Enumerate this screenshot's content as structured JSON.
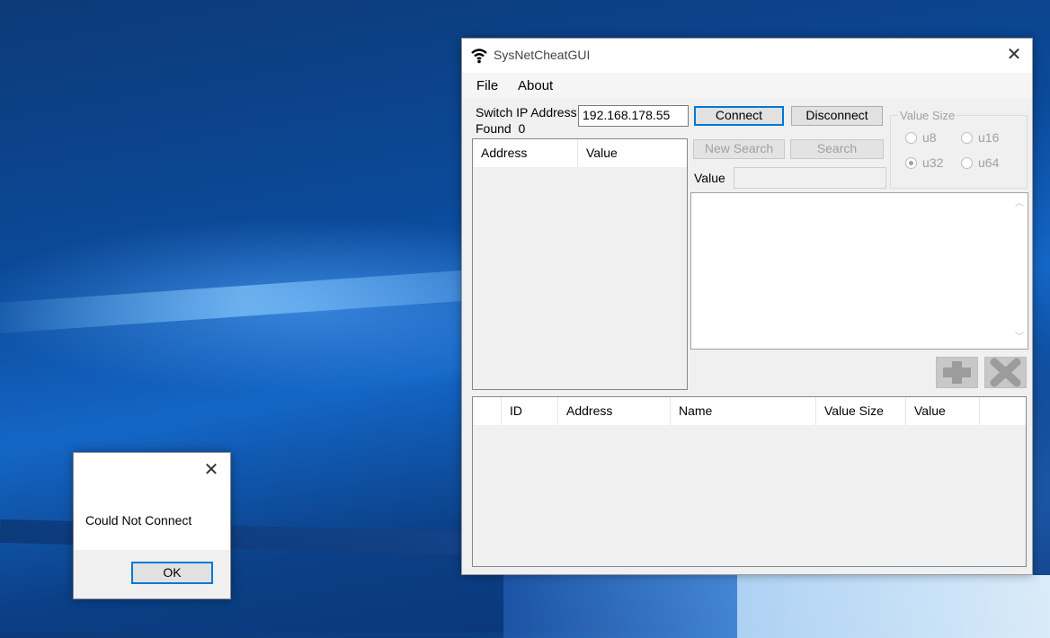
{
  "window": {
    "title": "SysNetCheatGUI",
    "icon": "wifi-icon",
    "menu": [
      "File",
      "About"
    ]
  },
  "connection": {
    "ip_label": "Switch IP Address",
    "ip_value": "192.168.178.55",
    "found_label": "Found",
    "found_count": "0",
    "connect_label": "Connect",
    "disconnect_label": "Disconnect"
  },
  "results_list": {
    "columns": [
      "Address",
      "Value"
    ]
  },
  "search": {
    "new_search_label": "New Search",
    "search_label": "Search",
    "value_label": "Value",
    "value_input": ""
  },
  "value_size": {
    "legend": "Value Size",
    "options": [
      "u8",
      "u16",
      "u32",
      "u64"
    ],
    "selected": "u32"
  },
  "actions": {
    "add_icon": "plus-icon",
    "remove_icon": "x-icon"
  },
  "cheats_list": {
    "columns": [
      "",
      "ID",
      "Address",
      "Name",
      "Value Size",
      "Value",
      ""
    ]
  },
  "dialog": {
    "message": "Could Not Connect",
    "ok_label": "OK"
  },
  "colors": {
    "focus_border": "#0078d7",
    "disabled_text": "#a0a0a0"
  }
}
